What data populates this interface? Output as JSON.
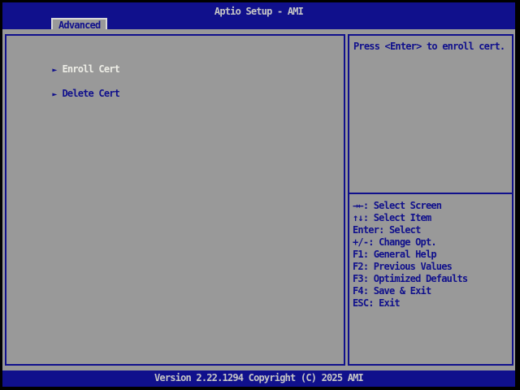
{
  "header": {
    "title": "Aptio Setup - AMI",
    "tab": "Advanced"
  },
  "menu": {
    "arrow": "►",
    "items": [
      {
        "label": "Enroll Cert",
        "selected": true
      },
      {
        "label": "Delete Cert",
        "selected": false
      }
    ]
  },
  "help": {
    "text": "Press <Enter> to enroll cert."
  },
  "keys": {
    "items": [
      "→←: Select Screen",
      "↑↓: Select Item",
      "Enter: Select",
      "+/-: Change Opt.",
      "F1: General Help",
      "F2: Previous Values",
      "F3: Optimized Defaults",
      "F4: Save & Exit",
      "ESC: Exit"
    ]
  },
  "footer": {
    "version": "Version 2.22.1294 Copyright (C) 2025 AMI"
  },
  "colors": {
    "navy": "#10108C",
    "gray": "#999999",
    "lightgray": "#C6C6C6",
    "white": "#EDEDE6",
    "black": "#000000"
  }
}
